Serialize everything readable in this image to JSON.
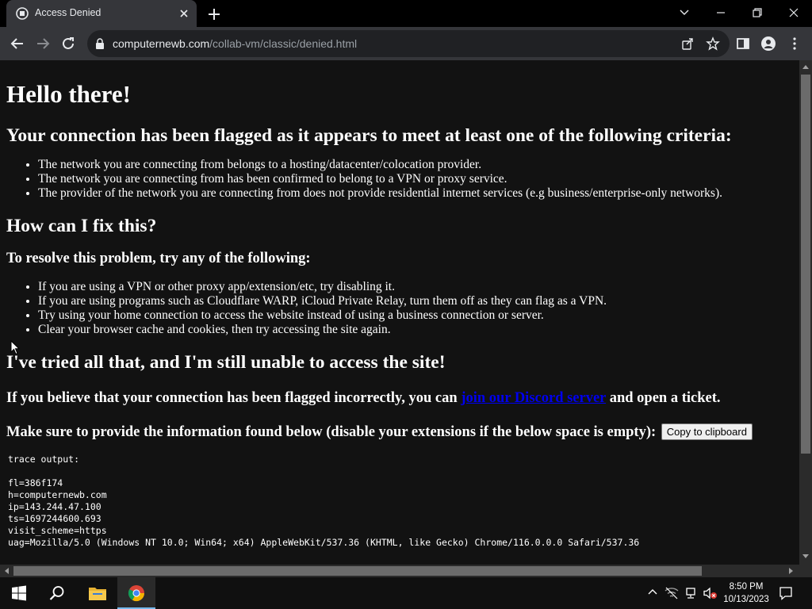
{
  "browser": {
    "tab": {
      "title": "Access Denied"
    },
    "url": {
      "domain": "computernewb.com",
      "path": "/collab-vm/classic/denied.html"
    }
  },
  "page": {
    "heading": "Hello there!",
    "criteria_heading": "Your connection has been flagged as it appears to meet at least one of the following criteria:",
    "criteria": [
      "The network you are connecting from belongs to a hosting/datacenter/colocation provider.",
      "The network you are connecting from has been confirmed to belong to a VPN or proxy service.",
      "The provider of the network you are connecting from does not provide residential internet services (e.g business/enterprise-only networks)."
    ],
    "fix_heading": "How can I fix this?",
    "resolve_heading": "To resolve this problem, try any of the following:",
    "fixes": [
      "If you are using a VPN or other proxy app/extension/etc, try disabling it.",
      "If you are using programs such as Cloudflare WARP, iCloud Private Relay, turn them off as they can flag as a VPN.",
      "Try using your home connection to access the website instead of using a business connection or server.",
      "Clear your browser cache and cookies, then try accessing the site again."
    ],
    "tried_heading": "I've tried all that, and I'm still unable to access the site!",
    "believe_prefix": "If you believe that your connection has been flagged incorrectly, you can ",
    "discord_link": "join our Discord server",
    "believe_suffix": " and open a ticket.",
    "provide_text": "Make sure to provide the information found below (disable your extensions if the below space is empty): ",
    "copy_button": "Copy to clipboard",
    "trace_lines": [
      "trace output:",
      "",
      "fl=386f174",
      "h=computernewb.com",
      "ip=143.244.47.100",
      "ts=1697244600.693",
      "visit_scheme=https",
      "uag=Mozilla/5.0 (Windows NT 10.0; Win64; x64) AppleWebKit/537.36 (KHTML, like Gecko) Chrome/116.0.0.0 Safari/537.36"
    ]
  },
  "taskbar": {
    "clock_time": "8:50 PM",
    "clock_date": "10/13/2023"
  },
  "colors": {
    "page_background": "#121212",
    "link": "#0000ee",
    "toolbar": "#35363a"
  },
  "icons": [
    "app-favicon-icon",
    "close-icon",
    "plus-icon",
    "chevron-down-icon",
    "minimize-icon",
    "restore-icon",
    "window-close-icon",
    "back-arrow-icon",
    "forward-arrow-icon",
    "reload-icon",
    "lock-icon",
    "share-icon",
    "star-icon",
    "side-panel-icon",
    "profile-icon",
    "kebab-menu-icon",
    "windows-start-icon",
    "search-icon",
    "file-explorer-icon",
    "chrome-icon",
    "chevron-up-icon",
    "network-icon",
    "speaker-muted-icon",
    "notification-icon"
  ]
}
